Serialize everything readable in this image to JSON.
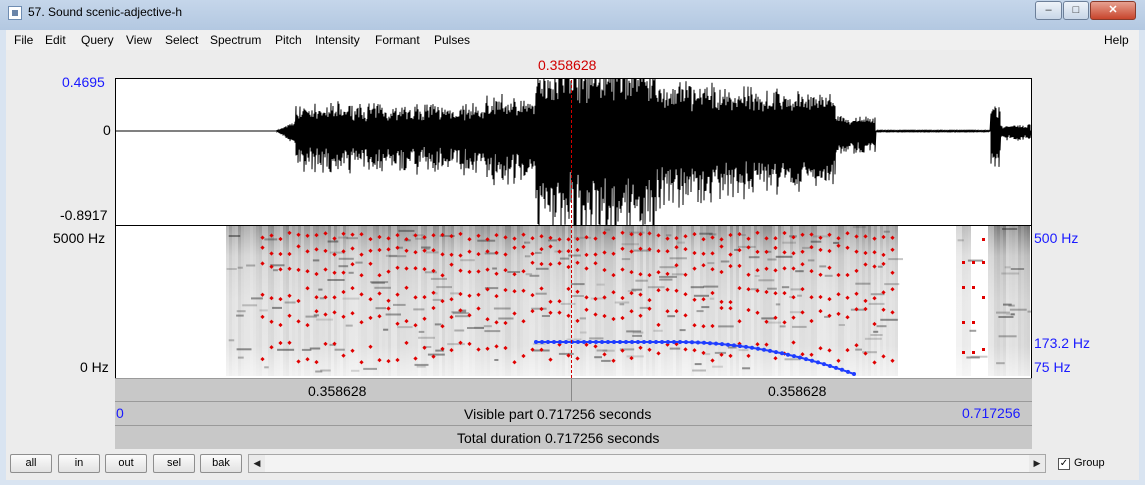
{
  "window": {
    "title": "57. Sound scenic-adjective-h",
    "minimize": "–",
    "maximize": "□",
    "close": "✕"
  },
  "menu": {
    "items": [
      "File",
      "Edit",
      "Query",
      "View",
      "Select",
      "Spectrum",
      "Pitch",
      "Intensity",
      "Formant",
      "Pulses"
    ],
    "help": "Help"
  },
  "cursor": {
    "time": "0.358628"
  },
  "waveform": {
    "top_value": "0.4695",
    "zero": "0",
    "bottom_value": "-0.8917"
  },
  "spectrogram": {
    "freq_top": "5000 Hz",
    "freq_bottom": "0 Hz",
    "pitch_top": "500 Hz",
    "pitch_mid": "173.2 Hz",
    "pitch_bottom": "75 Hz"
  },
  "selection": {
    "left_duration": "0.358628",
    "right_duration": "0.358628"
  },
  "visible": {
    "start": "0",
    "label": "Visible part 0.717256 seconds",
    "end": "0.717256"
  },
  "total": {
    "label": "Total duration 0.717256 seconds"
  },
  "buttons": {
    "all": "all",
    "in": "in",
    "out": "out",
    "sel": "sel",
    "bak": "bak"
  },
  "scroll": {
    "left": "◀",
    "right": "▶"
  },
  "group": {
    "label": "Group",
    "checked": true,
    "mark": "✓"
  }
}
